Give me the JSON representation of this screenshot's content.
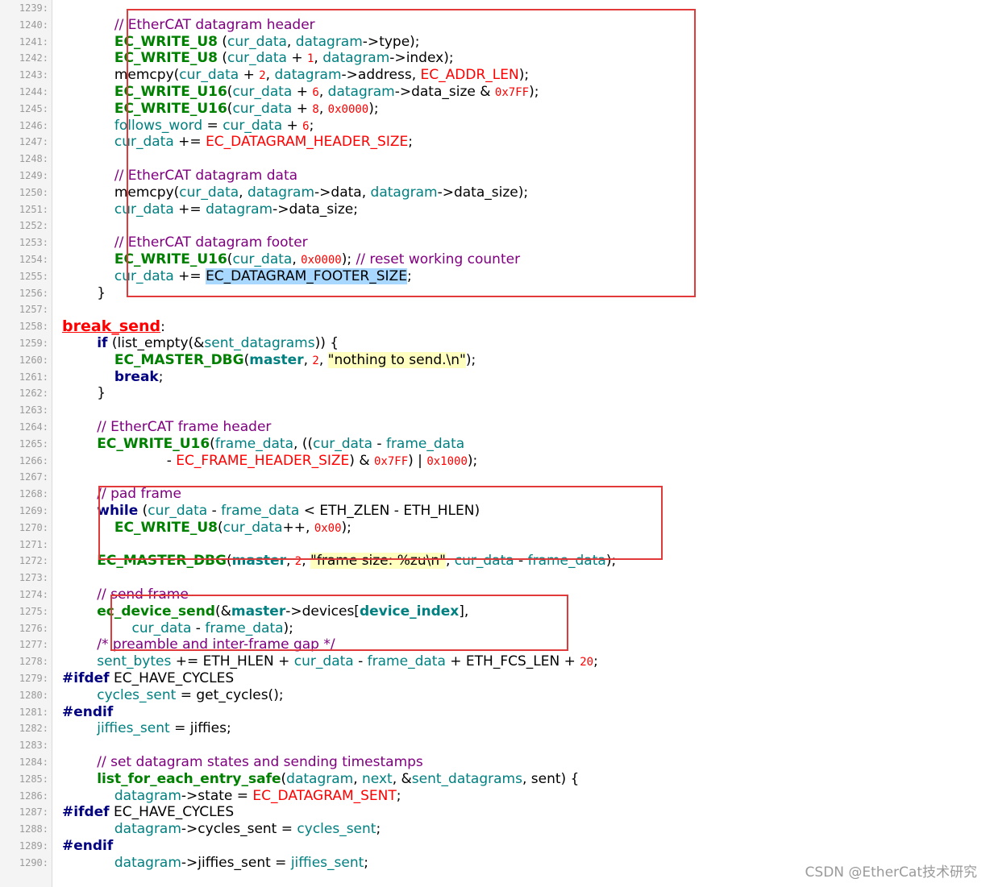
{
  "watermark": "CSDN @EtherCat技术研究",
  "lines": [
    {
      "n": "1239:",
      "tokens": []
    },
    {
      "n": "1240:",
      "tokens": [
        [
          "plain",
          "            "
        ],
        [
          "comment",
          "// EtherCAT datagram header"
        ]
      ]
    },
    {
      "n": "1241:",
      "tokens": [
        [
          "plain",
          "            "
        ],
        [
          "macro",
          "EC_WRITE_U8"
        ],
        [
          "plain",
          " ("
        ],
        [
          "var",
          "cur_data"
        ],
        [
          "plain",
          ", "
        ],
        [
          "var",
          "datagram"
        ],
        [
          "plain",
          "->"
        ],
        [
          "plain",
          "type"
        ],
        [
          "plain",
          ");"
        ]
      ]
    },
    {
      "n": "1242:",
      "tokens": [
        [
          "plain",
          "            "
        ],
        [
          "macro",
          "EC_WRITE_U8"
        ],
        [
          "plain",
          " ("
        ],
        [
          "var",
          "cur_data"
        ],
        [
          "plain",
          " + "
        ],
        [
          "num",
          "1"
        ],
        [
          "plain",
          ", "
        ],
        [
          "var",
          "datagram"
        ],
        [
          "plain",
          "->"
        ],
        [
          "plain",
          "index"
        ],
        [
          "plain",
          ");"
        ]
      ]
    },
    {
      "n": "1243:",
      "tokens": [
        [
          "plain",
          "            memcpy("
        ],
        [
          "var",
          "cur_data"
        ],
        [
          "plain",
          " + "
        ],
        [
          "num",
          "2"
        ],
        [
          "plain",
          ", "
        ],
        [
          "var",
          "datagram"
        ],
        [
          "plain",
          "->address, "
        ],
        [
          "const",
          "EC_ADDR_LEN"
        ],
        [
          "plain",
          ");"
        ]
      ]
    },
    {
      "n": "1244:",
      "tokens": [
        [
          "plain",
          "            "
        ],
        [
          "macro",
          "EC_WRITE_U16"
        ],
        [
          "plain",
          "("
        ],
        [
          "var",
          "cur_data"
        ],
        [
          "plain",
          " + "
        ],
        [
          "num",
          "6"
        ],
        [
          "plain",
          ", "
        ],
        [
          "var",
          "datagram"
        ],
        [
          "plain",
          "->data_size & "
        ],
        [
          "num",
          "0x7FF"
        ],
        [
          "plain",
          ");"
        ]
      ]
    },
    {
      "n": "1245:",
      "tokens": [
        [
          "plain",
          "            "
        ],
        [
          "macro",
          "EC_WRITE_U16"
        ],
        [
          "plain",
          "("
        ],
        [
          "var",
          "cur_data"
        ],
        [
          "plain",
          " + "
        ],
        [
          "num",
          "8"
        ],
        [
          "plain",
          ", "
        ],
        [
          "num",
          "0x0000"
        ],
        [
          "plain",
          ");"
        ]
      ]
    },
    {
      "n": "1246:",
      "tokens": [
        [
          "plain",
          "            "
        ],
        [
          "var",
          "follows_word"
        ],
        [
          "plain",
          " = "
        ],
        [
          "var",
          "cur_data"
        ],
        [
          "plain",
          " + "
        ],
        [
          "num",
          "6"
        ],
        [
          "plain",
          ";"
        ]
      ]
    },
    {
      "n": "1247:",
      "tokens": [
        [
          "plain",
          "            "
        ],
        [
          "var",
          "cur_data"
        ],
        [
          "plain",
          " += "
        ],
        [
          "const",
          "EC_DATAGRAM_HEADER_SIZE"
        ],
        [
          "plain",
          ";"
        ]
      ]
    },
    {
      "n": "1248:",
      "tokens": []
    },
    {
      "n": "1249:",
      "tokens": [
        [
          "plain",
          "            "
        ],
        [
          "comment",
          "// EtherCAT datagram data"
        ]
      ]
    },
    {
      "n": "1250:",
      "tokens": [
        [
          "plain",
          "            memcpy("
        ],
        [
          "var",
          "cur_data"
        ],
        [
          "plain",
          ", "
        ],
        [
          "var",
          "datagram"
        ],
        [
          "plain",
          "->data, "
        ],
        [
          "var",
          "datagram"
        ],
        [
          "plain",
          "->data_size);"
        ]
      ]
    },
    {
      "n": "1251:",
      "tokens": [
        [
          "plain",
          "            "
        ],
        [
          "var",
          "cur_data"
        ],
        [
          "plain",
          " += "
        ],
        [
          "var",
          "datagram"
        ],
        [
          "plain",
          "->data_size;"
        ]
      ]
    },
    {
      "n": "1252:",
      "tokens": []
    },
    {
      "n": "1253:",
      "tokens": [
        [
          "plain",
          "            "
        ],
        [
          "comment",
          "// EtherCAT datagram footer"
        ]
      ]
    },
    {
      "n": "1254:",
      "tokens": [
        [
          "plain",
          "            "
        ],
        [
          "macro",
          "EC_WRITE_U16"
        ],
        [
          "plain",
          "("
        ],
        [
          "var",
          "cur_data"
        ],
        [
          "plain",
          ", "
        ],
        [
          "num",
          "0x0000"
        ],
        [
          "plain",
          "); "
        ],
        [
          "comment",
          "// reset working counter"
        ]
      ]
    },
    {
      "n": "1255:",
      "tokens": [
        [
          "plain",
          "            "
        ],
        [
          "var",
          "cur_data"
        ],
        [
          "plain",
          " += "
        ],
        [
          "hl",
          "EC_DATAGRAM_FOOTER_SIZE"
        ],
        [
          "plain",
          ";"
        ]
      ]
    },
    {
      "n": "1256:",
      "tokens": [
        [
          "plain",
          "        }"
        ]
      ]
    },
    {
      "n": "1257:",
      "tokens": []
    },
    {
      "n": "1258:",
      "tokens": [
        [
          "label",
          "break_send"
        ],
        [
          "plain",
          ":"
        ]
      ]
    },
    {
      "n": "1259:",
      "tokens": [
        [
          "plain",
          "        "
        ],
        [
          "kw",
          "if"
        ],
        [
          "plain",
          " (list_empty(&"
        ],
        [
          "var",
          "sent_datagrams"
        ],
        [
          "plain",
          ")) {"
        ]
      ]
    },
    {
      "n": "1260:",
      "tokens": [
        [
          "plain",
          "            "
        ],
        [
          "macro",
          "EC_MASTER_DBG"
        ],
        [
          "plain",
          "("
        ],
        [
          "bold",
          "master"
        ],
        [
          "plain",
          ", "
        ],
        [
          "num",
          "2"
        ],
        [
          "plain",
          ", "
        ],
        [
          "str",
          "\"nothing to send.\\n\""
        ],
        [
          "plain",
          ");"
        ]
      ]
    },
    {
      "n": "1261:",
      "tokens": [
        [
          "plain",
          "            "
        ],
        [
          "kw",
          "break"
        ],
        [
          "plain",
          ";"
        ]
      ]
    },
    {
      "n": "1262:",
      "tokens": [
        [
          "plain",
          "        }"
        ]
      ]
    },
    {
      "n": "1263:",
      "tokens": []
    },
    {
      "n": "1264:",
      "tokens": [
        [
          "plain",
          "        "
        ],
        [
          "comment",
          "// EtherCAT frame header"
        ]
      ]
    },
    {
      "n": "1265:",
      "tokens": [
        [
          "plain",
          "        "
        ],
        [
          "macro",
          "EC_WRITE_U16"
        ],
        [
          "plain",
          "("
        ],
        [
          "var",
          "frame_data"
        ],
        [
          "plain",
          ", (("
        ],
        [
          "var",
          "cur_data"
        ],
        [
          "plain",
          " - "
        ],
        [
          "var",
          "frame_data"
        ]
      ]
    },
    {
      "n": "1266:",
      "tokens": [
        [
          "plain",
          "                        - "
        ],
        [
          "const",
          "EC_FRAME_HEADER_SIZE"
        ],
        [
          "plain",
          ") & "
        ],
        [
          "num",
          "0x7FF"
        ],
        [
          "plain",
          ") | "
        ],
        [
          "num",
          "0x1000"
        ],
        [
          "plain",
          ");"
        ]
      ]
    },
    {
      "n": "1267:",
      "tokens": []
    },
    {
      "n": "1268:",
      "tokens": [
        [
          "plain",
          "        "
        ],
        [
          "comment",
          "// pad frame"
        ]
      ]
    },
    {
      "n": "1269:",
      "tokens": [
        [
          "plain",
          "        "
        ],
        [
          "kw",
          "while"
        ],
        [
          "plain",
          " ("
        ],
        [
          "var",
          "cur_data"
        ],
        [
          "plain",
          " - "
        ],
        [
          "var",
          "frame_data"
        ],
        [
          "plain",
          " < ETH_ZLEN - ETH_HLEN)"
        ]
      ]
    },
    {
      "n": "1270:",
      "tokens": [
        [
          "plain",
          "            "
        ],
        [
          "macro",
          "EC_WRITE_U8"
        ],
        [
          "plain",
          "("
        ],
        [
          "var",
          "cur_data"
        ],
        [
          "plain",
          "++, "
        ],
        [
          "num",
          "0x00"
        ],
        [
          "plain",
          ");"
        ]
      ]
    },
    {
      "n": "1271:",
      "tokens": []
    },
    {
      "n": "1272:",
      "tokens": [
        [
          "plain",
          "        "
        ],
        [
          "macro",
          "EC_MASTER_DBG"
        ],
        [
          "plain",
          "("
        ],
        [
          "bold",
          "master"
        ],
        [
          "plain",
          ", "
        ],
        [
          "num",
          "2"
        ],
        [
          "plain",
          ", "
        ],
        [
          "str",
          "\"frame size: %zu\\n\""
        ],
        [
          "plain",
          ", "
        ],
        [
          "var",
          "cur_data"
        ],
        [
          "plain",
          " - "
        ],
        [
          "var",
          "frame_data"
        ],
        [
          "plain",
          ");"
        ]
      ]
    },
    {
      "n": "1273:",
      "tokens": []
    },
    {
      "n": "1274:",
      "tokens": [
        [
          "plain",
          "        "
        ],
        [
          "comment",
          "// send frame"
        ]
      ]
    },
    {
      "n": "1275:",
      "tokens": [
        [
          "plain",
          "        "
        ],
        [
          "macro",
          "ec_device_send"
        ],
        [
          "plain",
          "(&"
        ],
        [
          "bold",
          "master"
        ],
        [
          "plain",
          "->devices["
        ],
        [
          "bold",
          "device_index"
        ],
        [
          "plain",
          "],"
        ]
      ]
    },
    {
      "n": "1276:",
      "tokens": [
        [
          "plain",
          "                "
        ],
        [
          "var",
          "cur_data"
        ],
        [
          "plain",
          " - "
        ],
        [
          "var",
          "frame_data"
        ],
        [
          "plain",
          ");"
        ]
      ]
    },
    {
      "n": "1277:",
      "tokens": [
        [
          "plain",
          "        "
        ],
        [
          "comment",
          "/* preamble and inter-frame gap */"
        ]
      ]
    },
    {
      "n": "1278:",
      "tokens": [
        [
          "plain",
          "        "
        ],
        [
          "var",
          "sent_bytes"
        ],
        [
          "plain",
          " += ETH_HLEN + "
        ],
        [
          "var",
          "cur_data"
        ],
        [
          "plain",
          " - "
        ],
        [
          "var",
          "frame_data"
        ],
        [
          "plain",
          " + ETH_FCS_LEN + "
        ],
        [
          "num",
          "20"
        ],
        [
          "plain",
          ";"
        ]
      ]
    },
    {
      "n": "1279:",
      "tokens": [
        [
          "pre",
          "#ifdef"
        ],
        [
          "plain",
          " EC_HAVE_CYCLES"
        ]
      ]
    },
    {
      "n": "1280:",
      "tokens": [
        [
          "plain",
          "        "
        ],
        [
          "var",
          "cycles_sent"
        ],
        [
          "plain",
          " = get_cycles();"
        ]
      ]
    },
    {
      "n": "1281:",
      "tokens": [
        [
          "pre",
          "#endif"
        ]
      ]
    },
    {
      "n": "1282:",
      "tokens": [
        [
          "plain",
          "        "
        ],
        [
          "var",
          "jiffies_sent"
        ],
        [
          "plain",
          " = jiffies;"
        ]
      ]
    },
    {
      "n": "1283:",
      "tokens": []
    },
    {
      "n": "1284:",
      "tokens": [
        [
          "plain",
          "        "
        ],
        [
          "comment",
          "// set datagram states and sending timestamps"
        ]
      ]
    },
    {
      "n": "1285:",
      "tokens": [
        [
          "plain",
          "        "
        ],
        [
          "macro",
          "list_for_each_entry_safe"
        ],
        [
          "plain",
          "("
        ],
        [
          "var",
          "datagram"
        ],
        [
          "plain",
          ", "
        ],
        [
          "var",
          "next"
        ],
        [
          "plain",
          ", &"
        ],
        [
          "var",
          "sent_datagrams"
        ],
        [
          "plain",
          ", sent) {"
        ]
      ]
    },
    {
      "n": "1286:",
      "tokens": [
        [
          "plain",
          "            "
        ],
        [
          "var",
          "datagram"
        ],
        [
          "plain",
          "->state = "
        ],
        [
          "const",
          "EC_DATAGRAM_SENT"
        ],
        [
          "plain",
          ";"
        ]
      ]
    },
    {
      "n": "1287:",
      "tokens": [
        [
          "pre",
          "#ifdef"
        ],
        [
          "plain",
          " EC_HAVE_CYCLES"
        ]
      ]
    },
    {
      "n": "1288:",
      "tokens": [
        [
          "plain",
          "            "
        ],
        [
          "var",
          "datagram"
        ],
        [
          "plain",
          "->cycles_sent = "
        ],
        [
          "var",
          "cycles_sent"
        ],
        [
          "plain",
          ";"
        ]
      ]
    },
    {
      "n": "1289:",
      "tokens": [
        [
          "pre",
          "#endif"
        ]
      ]
    },
    {
      "n": "1290:",
      "tokens": [
        [
          "plain",
          "            "
        ],
        [
          "var",
          "datagram"
        ],
        [
          "plain",
          "->jiffies_sent = "
        ],
        [
          "var",
          "jiffies_sent"
        ],
        [
          "plain",
          ";"
        ]
      ]
    }
  ],
  "highlight_boxes": [
    {
      "label": "datagram-write-block"
    },
    {
      "label": "pad-frame-block"
    },
    {
      "label": "send-frame-block"
    }
  ]
}
